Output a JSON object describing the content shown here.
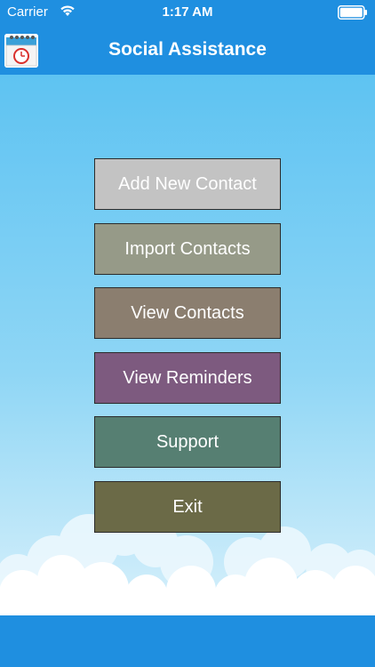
{
  "status_bar": {
    "carrier": "Carrier",
    "time": "1:17 AM"
  },
  "nav": {
    "title": "Social Assistance",
    "app_icon": "calendar-clock-icon"
  },
  "menu": {
    "buttons": [
      {
        "label": "Add New Contact",
        "color": "#c3c3c3"
      },
      {
        "label": "Import Contacts",
        "color": "#969a88"
      },
      {
        "label": "View Contacts",
        "color": "#8b7e6f"
      },
      {
        "label": "View Reminders",
        "color": "#7d5a7f"
      },
      {
        "label": "Support",
        "color": "#567f72"
      },
      {
        "label": "Exit",
        "color": "#6b6a47"
      }
    ]
  },
  "colors": {
    "bar_blue": "#1f8fe0",
    "sky_top": "#5ec3f2",
    "sky_bottom": "#d7f0fb"
  }
}
